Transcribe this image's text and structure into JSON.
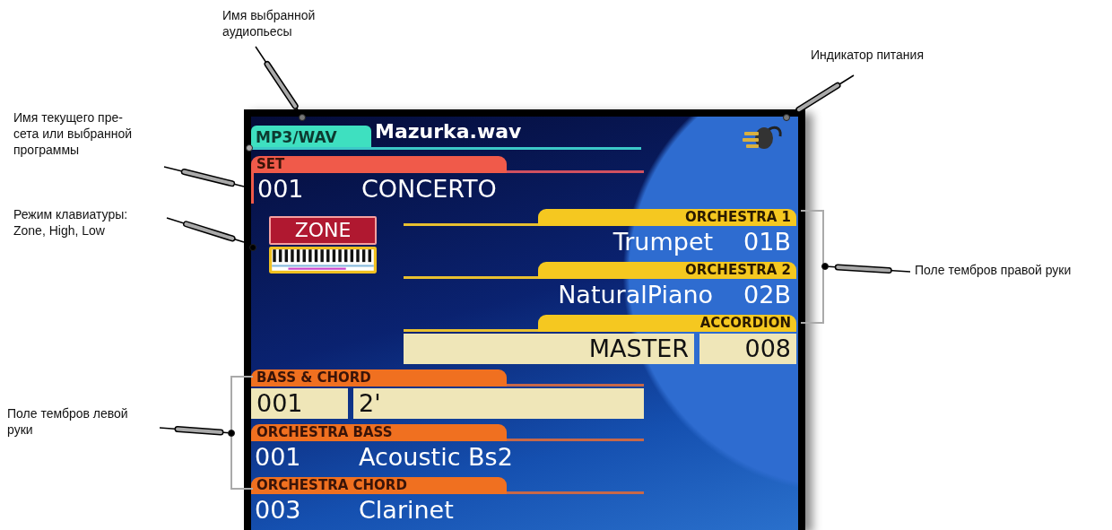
{
  "display": {
    "player": {
      "tab": "MP3/WAV",
      "file": "Mazurka.wav"
    },
    "set": {
      "label": "SET",
      "number": "001",
      "name": "CONCERTO"
    },
    "keyboard_mode": "ZONE",
    "right_hand": [
      {
        "kind": "plain",
        "label": "ORCHESTRA 1",
        "name": "Trumpet",
        "code": "01B"
      },
      {
        "kind": "plain",
        "label": "ORCHESTRA 2",
        "name": "NaturalPiano",
        "code": "02B"
      },
      {
        "kind": "boxed",
        "label": "ACCORDION",
        "name": "MASTER",
        "code": "008"
      }
    ],
    "left_hand": [
      {
        "kind": "boxed",
        "label": "BASS & CHORD",
        "number": "001",
        "name": "2'"
      },
      {
        "kind": "plain",
        "label": "ORCHESTRA BASS",
        "number": "001",
        "name": "Acoustic Bs2"
      },
      {
        "kind": "plain",
        "label": "ORCHESTRA CHORD",
        "number": "003",
        "name": "Clarinet"
      }
    ]
  },
  "callouts": [
    {
      "text": "Имя выбранной\nаудиопьесы"
    },
    {
      "text": "Индикатор питания"
    },
    {
      "text": "Имя текущего пре-\nсета или выбранной\nпрограммы"
    },
    {
      "text": "Режим клавиатуры:\nZone, High, Low"
    },
    {
      "text": "Поле тембров правой руки"
    },
    {
      "text": "Поле тембров левой\nруки"
    }
  ]
}
